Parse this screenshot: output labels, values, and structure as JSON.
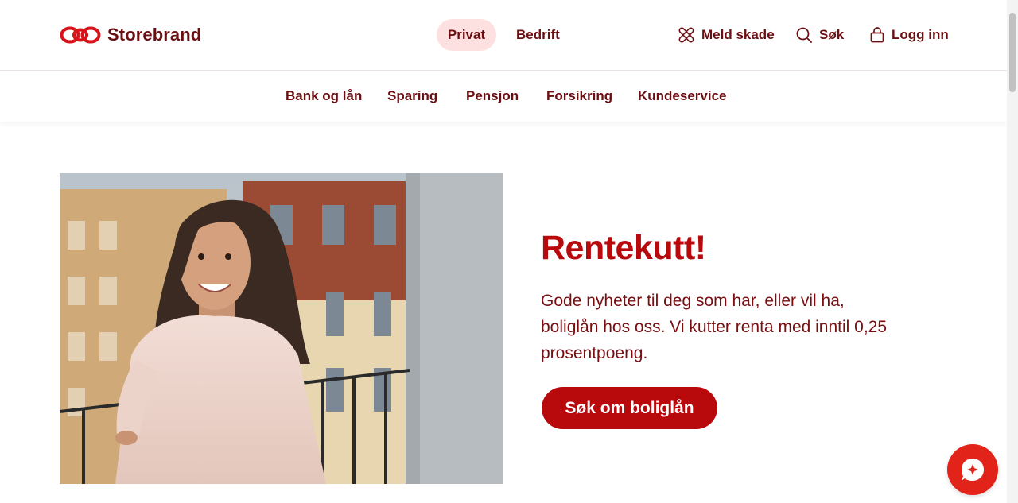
{
  "header": {
    "brand": "Storebrand",
    "segments": [
      {
        "label": "Privat",
        "active": true
      },
      {
        "label": "Bedrift",
        "active": false
      }
    ],
    "utilities": [
      {
        "label": "Meld skade",
        "icon": "cross-bandage-icon"
      },
      {
        "label": "Søk",
        "icon": "search-icon"
      },
      {
        "label": "Logg inn",
        "icon": "lock-icon"
      }
    ]
  },
  "nav": {
    "items": [
      "Bank og lån",
      "Sparing",
      "Pensjon",
      "Forsikring",
      "Kundeservice"
    ]
  },
  "hero": {
    "title": "Rentekutt!",
    "body": "Gode nyheter til deg som har, eller vil ha, boliglån hos oss. Vi kutter renta med inntil 0,25 prosentpoeng.",
    "cta_label": "Søk om boliglån"
  },
  "chat": {
    "icon": "chat-bubble-icon"
  },
  "colors": {
    "brand_red": "#b8090c",
    "text_dark_red": "#6b0f12",
    "active_segment_bg": "#fde0e0",
    "chat_red": "#e2231a"
  }
}
